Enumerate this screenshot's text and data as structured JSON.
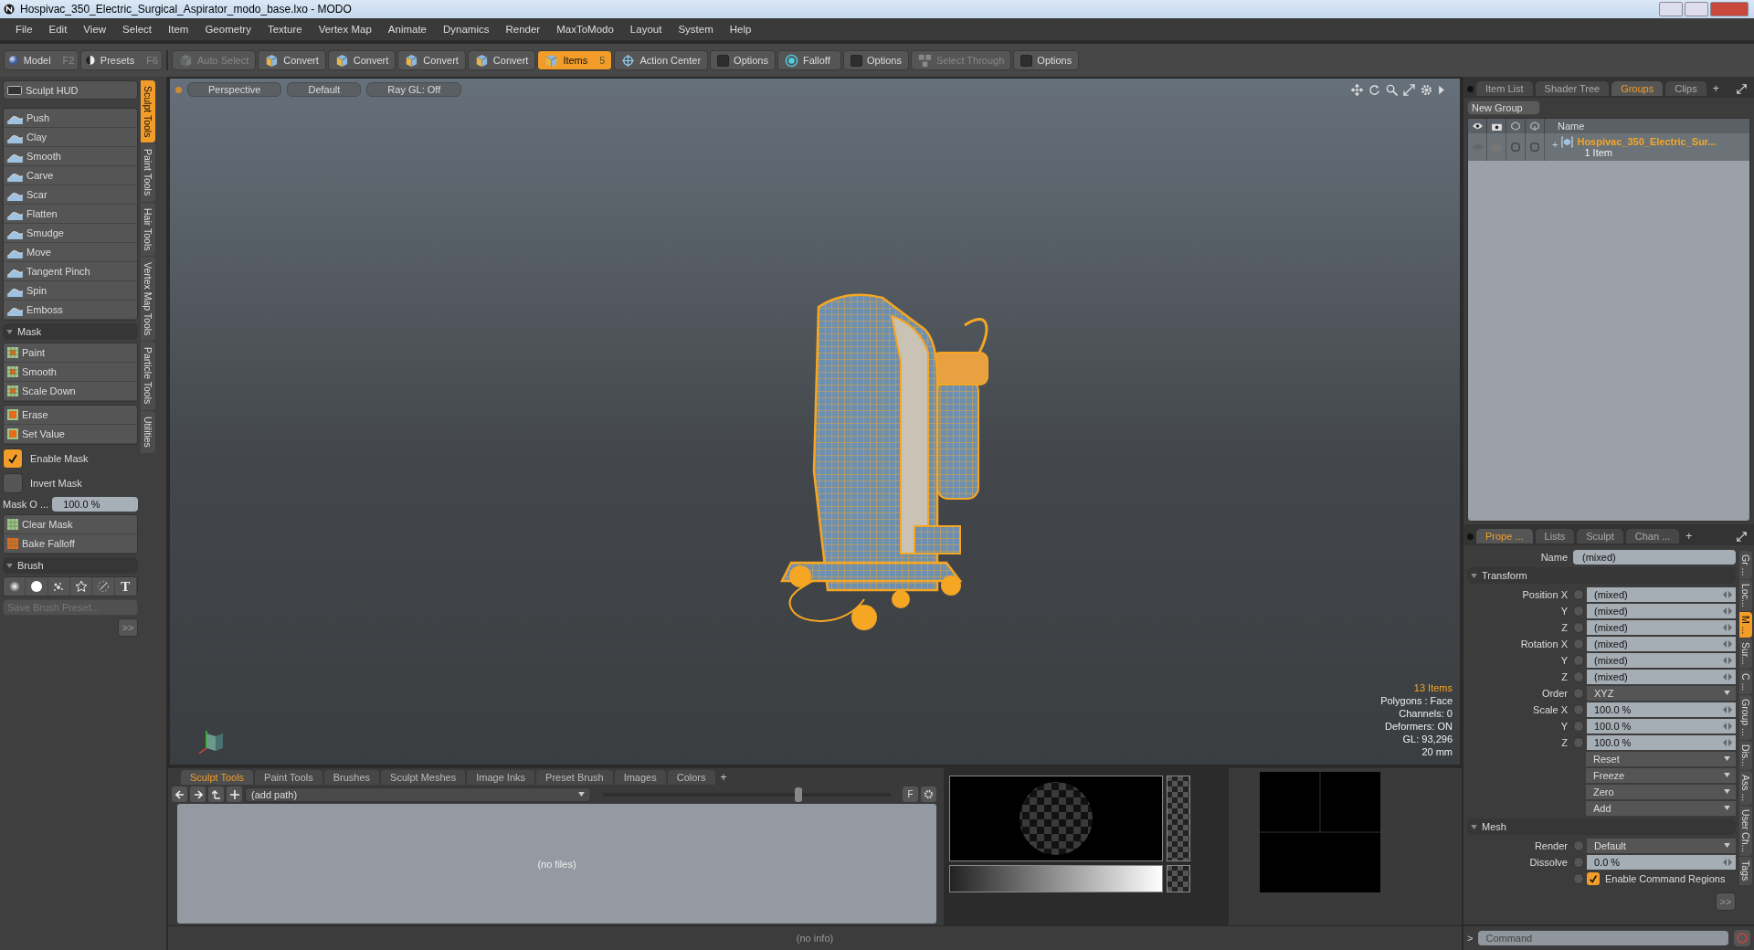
{
  "window": {
    "title": "Hospivac_350_Electric_Surgical_Aspirator_modo_base.lxo - MODO"
  },
  "menu": [
    "File",
    "Edit",
    "View",
    "Select",
    "Item",
    "Geometry",
    "Texture",
    "Vertex Map",
    "Animate",
    "Dynamics",
    "Render",
    "MaxToModo",
    "Layout",
    "System",
    "Help"
  ],
  "toolbar": {
    "modes": [
      {
        "label": "Model",
        "shortcut": "F2",
        "kind": "sphere"
      },
      {
        "label": "Presets",
        "shortcut": "F6",
        "kind": "half"
      }
    ],
    "tools": [
      {
        "label": "Auto Select",
        "kind": "cube",
        "disabled": true,
        "selected": false
      },
      {
        "label": "Convert",
        "kind": "cube",
        "disabled": false,
        "selected": false
      },
      {
        "label": "Convert",
        "kind": "cube",
        "disabled": false,
        "selected": false
      },
      {
        "label": "Convert",
        "kind": "cube",
        "disabled": false,
        "selected": false
      },
      {
        "label": "Convert",
        "kind": "cube",
        "disabled": false,
        "selected": false
      },
      {
        "label": "Items",
        "kind": "cube",
        "disabled": false,
        "selected": true,
        "shortcut": "5"
      },
      {
        "label": "Action Center",
        "kind": "target",
        "disabled": false,
        "selected": false
      },
      {
        "label": "Options",
        "kind": "box",
        "disabled": false,
        "selected": false
      },
      {
        "label": "Falloff",
        "kind": "falloff",
        "disabled": false,
        "selected": false
      },
      {
        "label": "Options",
        "kind": "box",
        "disabled": false,
        "selected": false
      },
      {
        "label": "Select Through",
        "kind": "through",
        "disabled": true,
        "selected": false
      },
      {
        "label": "Options",
        "kind": "box",
        "disabled": false,
        "selected": false
      }
    ]
  },
  "left_panel": {
    "hud_button": "Sculpt HUD",
    "sculpt_tools": [
      "Push",
      "Clay",
      "Smooth",
      "Carve",
      "Scar",
      "Flatten",
      "Smudge",
      "Move",
      "Tangent Pinch",
      "Spin",
      "Emboss"
    ],
    "mask_title": "Mask",
    "mask_tools": [
      "Paint",
      "Smooth",
      "Scale Down"
    ],
    "mask_tools_2": [
      "Erase",
      "Set Value"
    ],
    "toggles": [
      {
        "label": "Enable Mask",
        "checked": true
      },
      {
        "label": "Invert Mask",
        "checked": false
      }
    ],
    "mask_opacity": {
      "label": "Mask O ...",
      "value": "100.0 %"
    },
    "mask_actions": [
      "Clear Mask",
      "Bake Falloff"
    ],
    "brush_title": "Brush",
    "brush_text_icon": "T",
    "preset_placeholder": "Save Brush Preset...",
    "more_button": ">>",
    "vertical_tabs": [
      {
        "label": "Sculpt Tools",
        "selected": true
      },
      {
        "label": "Paint Tools",
        "selected": false
      },
      {
        "label": "Hair Tools",
        "selected": false
      },
      {
        "label": "Vertex Map Tools",
        "selected": false
      },
      {
        "label": "Particle Tools",
        "selected": false
      },
      {
        "label": "Utilities",
        "selected": false
      }
    ]
  },
  "viewport": {
    "tabs": [
      "Perspective",
      "Default",
      "Ray GL: Off"
    ],
    "info": [
      {
        "text": "13 Items",
        "kind": "count"
      },
      {
        "text": "Polygons : Face",
        "kind": "stat"
      },
      {
        "text": "Channels: 0",
        "kind": "stat"
      },
      {
        "text": "Deformers: ON",
        "kind": "stat"
      },
      {
        "text": "GL: 93,296",
        "kind": "stat"
      },
      {
        "text": "20 mm",
        "kind": "stat"
      }
    ]
  },
  "browser": {
    "tabs": [
      {
        "label": "Sculpt Tools",
        "selected": true
      },
      {
        "label": "Paint Tools",
        "selected": false
      },
      {
        "label": "Brushes",
        "selected": false
      },
      {
        "label": "Sculpt Meshes",
        "selected": false
      },
      {
        "label": "Image Inks",
        "selected": false
      },
      {
        "label": "Preset Brush",
        "selected": false
      },
      {
        "label": "Images",
        "selected": false
      },
      {
        "label": "Colors",
        "selected": false
      }
    ],
    "add_tab": "+",
    "path": "(add path)",
    "thumbnail_slider": {
      "level": 0.68
    },
    "filter_button": "F",
    "empty_text": "(no files)"
  },
  "status_bar": "(no info)",
  "groups_panel": {
    "tabs": [
      {
        "label": "Item List",
        "selected": false
      },
      {
        "label": "Shader Tree",
        "selected": false
      },
      {
        "label": "Groups",
        "selected": true
      },
      {
        "label": "Clips",
        "selected": false
      }
    ],
    "add_tab": "+",
    "new_group": "New Group",
    "name_header": "Name",
    "rows": [
      {
        "expander": "+",
        "name": "Hospivac_350_Electric_Sur...",
        "count": "1 Item"
      }
    ]
  },
  "properties": {
    "tabs": [
      {
        "label": "Prope ...",
        "selected": true
      },
      {
        "label": "Lists",
        "selected": false
      },
      {
        "label": "Sculpt",
        "selected": false
      },
      {
        "label": "Chan ...",
        "selected": false
      }
    ],
    "add_tab": "+",
    "name_label": "Name",
    "name_value": "(mixed)",
    "sections": [
      {
        "title": "Transform",
        "rows": [
          {
            "kind": "value",
            "label": "Position X",
            "value": "(mixed)"
          },
          {
            "kind": "value",
            "label": "Y",
            "value": "(mixed)"
          },
          {
            "kind": "value",
            "label": "Z",
            "value": "(mixed)"
          },
          {
            "kind": "value",
            "label": "Rotation X",
            "value": "(mixed)"
          },
          {
            "kind": "value",
            "label": "Y",
            "value": "(mixed)"
          },
          {
            "kind": "value",
            "label": "Z",
            "value": "(mixed)"
          },
          {
            "kind": "dropdown",
            "label": "Order",
            "value": "XYZ"
          },
          {
            "kind": "value",
            "label": "Scale X",
            "value": "100.0 %"
          },
          {
            "kind": "value",
            "label": "Y",
            "value": "100.0 %"
          },
          {
            "kind": "value",
            "label": "Z",
            "value": "100.0 %"
          },
          {
            "kind": "action",
            "value": "Reset"
          },
          {
            "kind": "action",
            "value": "Freeze"
          },
          {
            "kind": "action",
            "value": "Zero"
          },
          {
            "kind": "action",
            "value": "Add"
          }
        ]
      },
      {
        "title": "Mesh",
        "rows": [
          {
            "kind": "dropdown",
            "label": "Render",
            "value": "Default"
          },
          {
            "kind": "value",
            "label": "Dissolve",
            "value": "0.0 %"
          },
          {
            "kind": "checkbox",
            "value": "Enable Command Regions",
            "checked": true
          }
        ]
      }
    ],
    "more_button": ">>",
    "side_tabs": [
      {
        "label": "Gr ...",
        "selected": false
      },
      {
        "label": "Loc...",
        "selected": false
      },
      {
        "label": "M ...",
        "selected": true
      },
      {
        "label": "Sur...",
        "selected": false
      },
      {
        "label": "C ...",
        "selected": false
      },
      {
        "label": "Group ...",
        "selected": false
      },
      {
        "label": "Dis...",
        "selected": false
      },
      {
        "label": "Ass ...",
        "selected": false
      },
      {
        "label": "User Ch...",
        "selected": false
      },
      {
        "label": "Tags",
        "selected": false
      }
    ]
  },
  "command": {
    "prompt": ">",
    "placeholder": "Command"
  }
}
